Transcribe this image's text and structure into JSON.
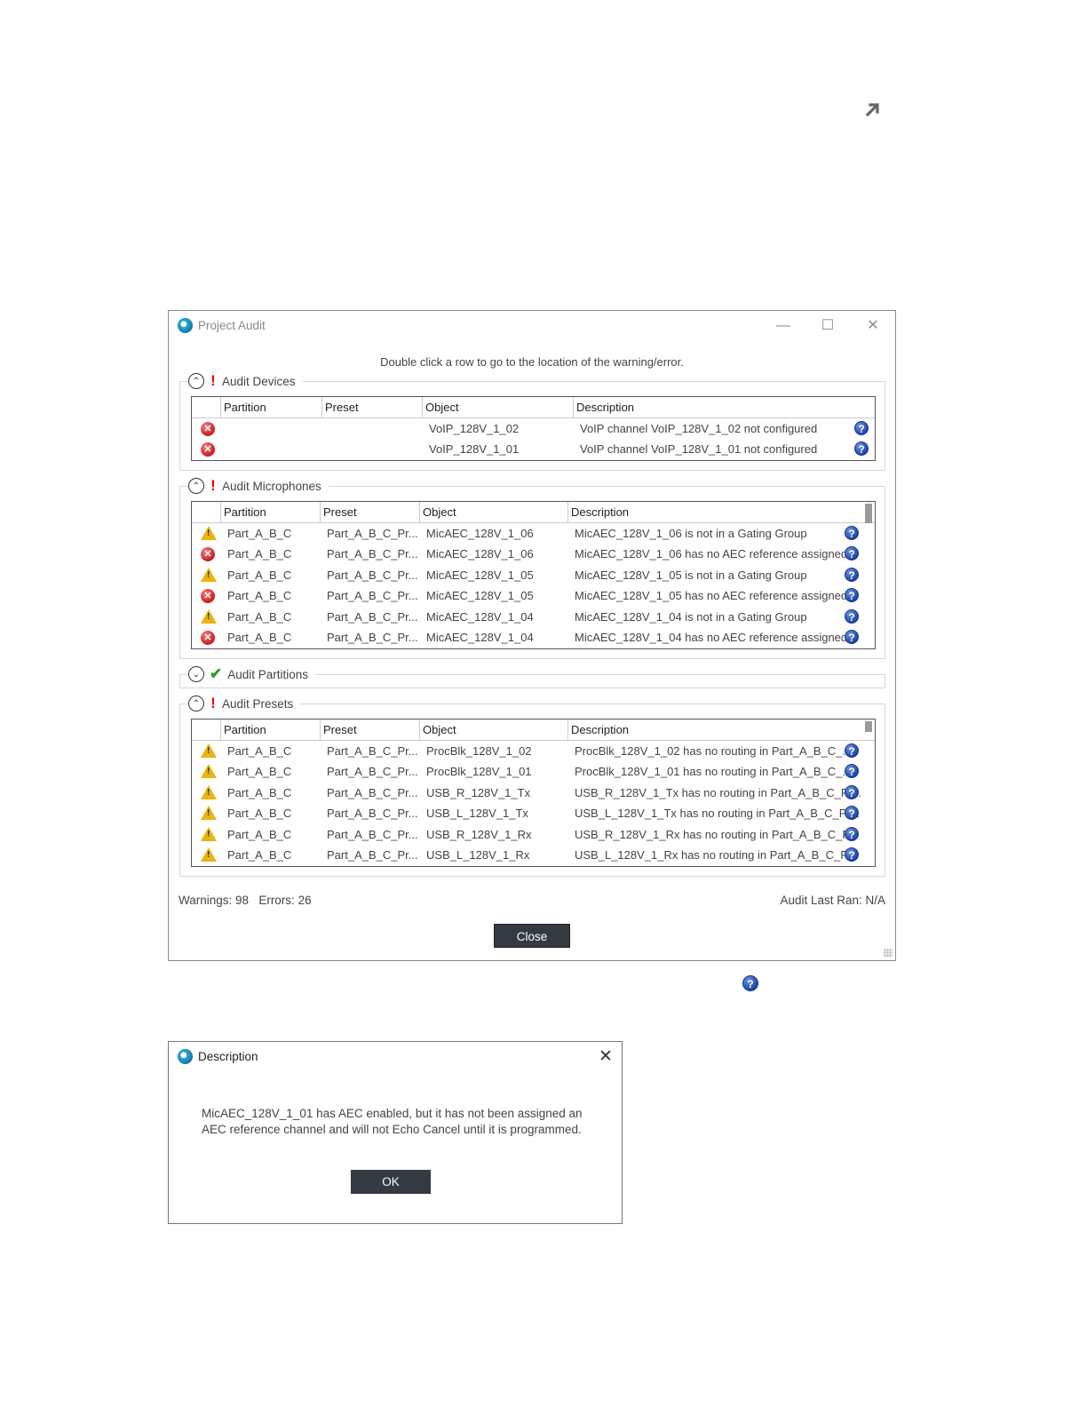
{
  "page": {
    "corner_icon": "expand-arrow-icon",
    "standalone_help_icon": "help-icon"
  },
  "window": {
    "title": "Project Audit",
    "controls": {
      "minimize": "—",
      "maximize": "☐",
      "close": "✕"
    },
    "hint": "Double click a row to go to the location of the warning/error.",
    "columns": {
      "partition": "Partition",
      "preset": "Preset",
      "object": "Object",
      "description": "Description"
    },
    "sections": {
      "devices": {
        "label": "Audit Devices",
        "status": "error",
        "rows": [
          {
            "type": "error",
            "partition": "",
            "preset": "",
            "object": "VoIP_128V_1_02",
            "description": "VoIP channel VoIP_128V_1_02 not configured"
          },
          {
            "type": "error",
            "partition": "",
            "preset": "",
            "object": "VoIP_128V_1_01",
            "description": "VoIP channel VoIP_128V_1_01 not configured"
          }
        ]
      },
      "microphones": {
        "label": "Audit Microphones",
        "status": "error",
        "rows": [
          {
            "type": "warning",
            "partition": "Part_A_B_C",
            "preset": "Part_A_B_C_Pr...",
            "object": "MicAEC_128V_1_06",
            "description": "MicAEC_128V_1_06 is not in a Gating Group"
          },
          {
            "type": "error",
            "partition": "Part_A_B_C",
            "preset": "Part_A_B_C_Pr...",
            "object": "MicAEC_128V_1_06",
            "description": "MicAEC_128V_1_06 has no AEC reference assigned"
          },
          {
            "type": "warning",
            "partition": "Part_A_B_C",
            "preset": "Part_A_B_C_Pr...",
            "object": "MicAEC_128V_1_05",
            "description": "MicAEC_128V_1_05 is not in a Gating Group"
          },
          {
            "type": "error",
            "partition": "Part_A_B_C",
            "preset": "Part_A_B_C_Pr...",
            "object": "MicAEC_128V_1_05",
            "description": "MicAEC_128V_1_05 has no AEC reference assigned"
          },
          {
            "type": "warning",
            "partition": "Part_A_B_C",
            "preset": "Part_A_B_C_Pr...",
            "object": "MicAEC_128V_1_04",
            "description": "MicAEC_128V_1_04 is not in a Gating Group"
          },
          {
            "type": "error",
            "partition": "Part_A_B_C",
            "preset": "Part_A_B_C_Pr...",
            "object": "MicAEC_128V_1_04",
            "description": "MicAEC_128V_1_04 has no AEC reference assigned"
          }
        ]
      },
      "partitions": {
        "label": "Audit Partitions",
        "status": "ok"
      },
      "presets": {
        "label": "Audit Presets",
        "status": "error",
        "rows": [
          {
            "type": "warning",
            "partition": "Part_A_B_C",
            "preset": "Part_A_B_C_Pr...",
            "object": "ProcBlk_128V_1_02",
            "description": "ProcBlk_128V_1_02 has no routing in Part_A_B_C_..."
          },
          {
            "type": "warning",
            "partition": "Part_A_B_C",
            "preset": "Part_A_B_C_Pr...",
            "object": "ProcBlk_128V_1_01",
            "description": "ProcBlk_128V_1_01 has no routing in Part_A_B_C_..."
          },
          {
            "type": "warning",
            "partition": "Part_A_B_C",
            "preset": "Part_A_B_C_Pr...",
            "object": "USB_R_128V_1_Tx",
            "description": "USB_R_128V_1_Tx has no routing in Part_A_B_C_Pr..."
          },
          {
            "type": "warning",
            "partition": "Part_A_B_C",
            "preset": "Part_A_B_C_Pr...",
            "object": "USB_L_128V_1_Tx",
            "description": "USB_L_128V_1_Tx has no routing in Part_A_B_C_Pr..."
          },
          {
            "type": "warning",
            "partition": "Part_A_B_C",
            "preset": "Part_A_B_C_Pr...",
            "object": "USB_R_128V_1_Rx",
            "description": "USB_R_128V_1_Rx has no routing in Part_A_B_C_P..."
          },
          {
            "type": "warning",
            "partition": "Part_A_B_C",
            "preset": "Part_A_B_C_Pr...",
            "object": "USB_L_128V_1_Rx",
            "description": "USB_L_128V_1_Rx has no routing in Part_A_B_C_P..."
          }
        ]
      }
    },
    "footer": {
      "warnings": "Warnings: 98",
      "errors": "Errors: 26",
      "last_ran": "Audit Last Ran: N/A"
    },
    "close_button": "Close"
  },
  "dialog": {
    "title": "Description",
    "close": "✕",
    "message": "MicAEC_128V_1_01 has AEC enabled, but it has not been assigned an AEC reference channel and will not Echo Cancel until it is programmed.",
    "ok_button": "OK"
  }
}
